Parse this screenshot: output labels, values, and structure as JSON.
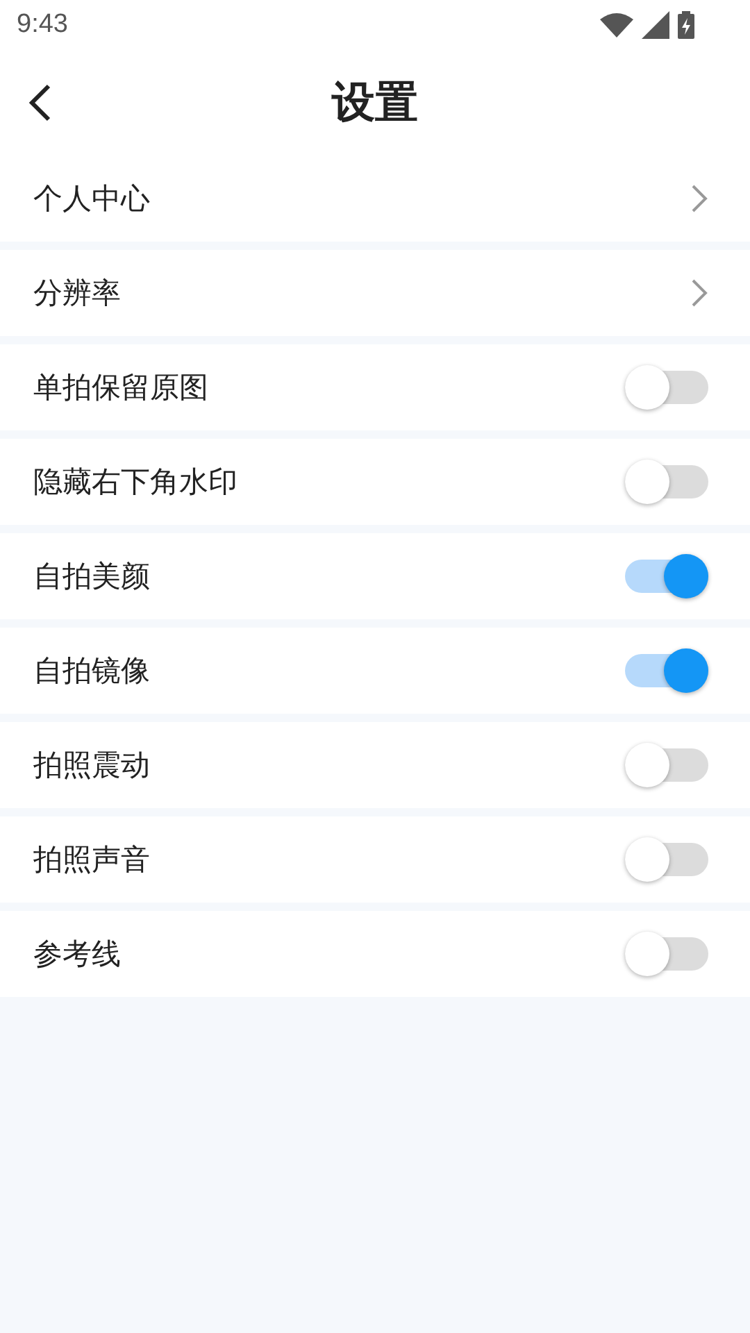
{
  "status_bar": {
    "time": "9:43"
  },
  "header": {
    "title": "设置"
  },
  "items": [
    {
      "kind": "link",
      "label": "个人中心"
    },
    {
      "kind": "link",
      "label": "分辨率"
    },
    {
      "kind": "toggle",
      "label": "单拍保留原图",
      "on": false
    },
    {
      "kind": "toggle",
      "label": "隐藏右下角水印",
      "on": false
    },
    {
      "kind": "toggle",
      "label": "自拍美颜",
      "on": true
    },
    {
      "kind": "toggle",
      "label": "自拍镜像",
      "on": true
    },
    {
      "kind": "toggle",
      "label": "拍照震动",
      "on": false
    },
    {
      "kind": "toggle",
      "label": "拍照声音",
      "on": false
    },
    {
      "kind": "toggle",
      "label": "参考线",
      "on": false
    }
  ]
}
